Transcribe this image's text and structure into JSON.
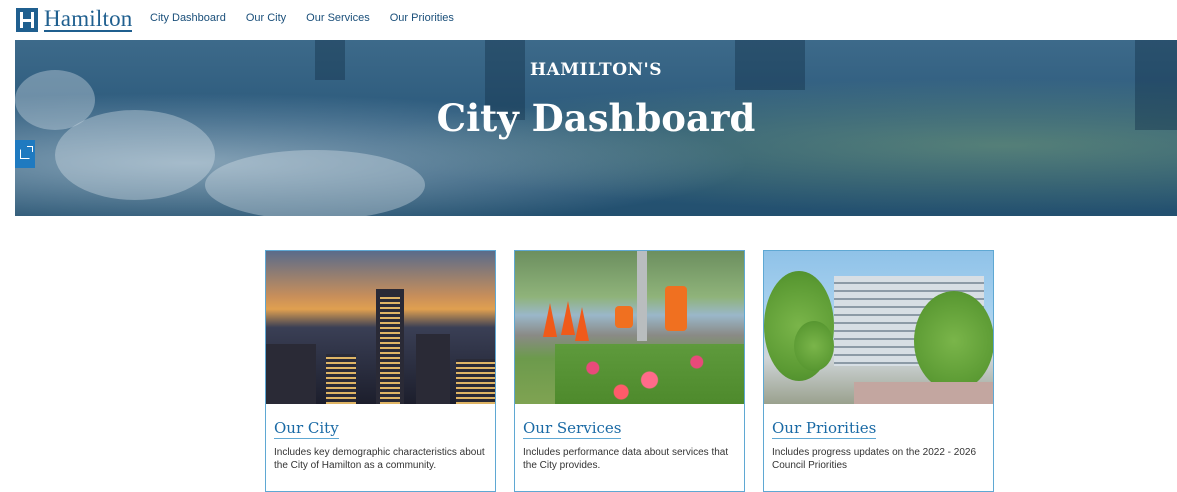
{
  "header": {
    "logo_text": "Hamilton",
    "nav": [
      "City Dashboard",
      "Our City",
      "Our Services",
      "Our Priorities"
    ]
  },
  "hero": {
    "subtitle": "HAMILTON'S",
    "title": "City Dashboard",
    "share_icon": "share-icon"
  },
  "cards": [
    {
      "title": "Our City",
      "description": "Includes key demographic characteristics about the City of Hamilton as a community."
    },
    {
      "title": "Our Services",
      "description": "Includes performance data about services that the City provides."
    },
    {
      "title": "Our Priorities",
      "description": "Includes progress updates on the 2022 - 2026 Council Priorities"
    }
  ],
  "colors": {
    "brand": "#1f5f8f",
    "link": "#1a6aa5",
    "card_border": "#5fa8d3",
    "share_button": "#1f7ac0"
  }
}
